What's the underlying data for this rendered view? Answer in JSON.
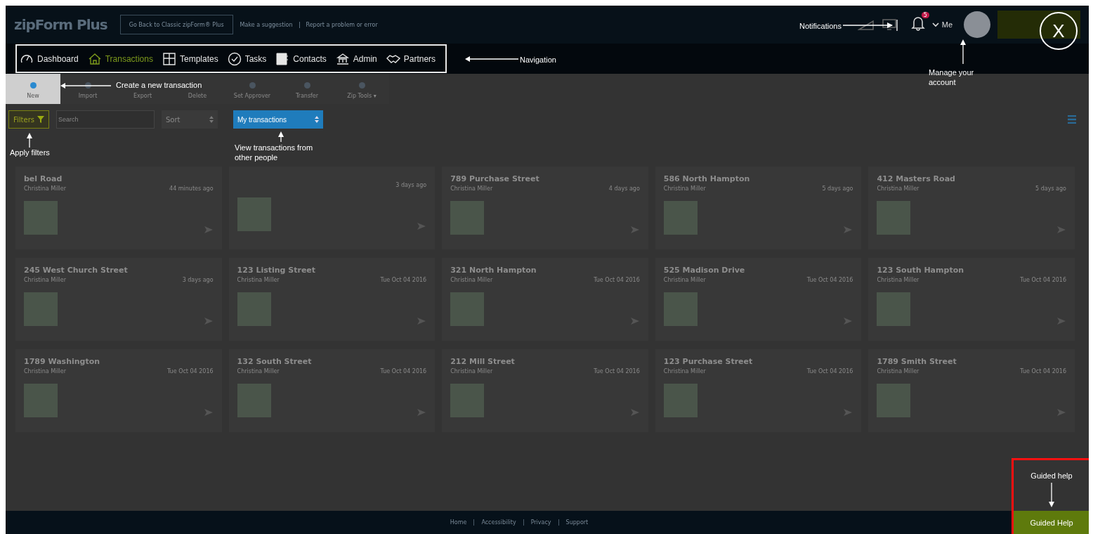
{
  "header": {
    "logo": "zipForm Plus",
    "back_button": "Go Back to Classic zipForm® Plus",
    "links": [
      "Make a suggestion",
      "Report a problem or error"
    ],
    "notification_count": "5",
    "account_menu": "Me"
  },
  "nav": [
    {
      "label": "Dashboard",
      "selected": false
    },
    {
      "label": "Transactions",
      "selected": true
    },
    {
      "label": "Templates",
      "selected": false
    },
    {
      "label": "Tasks",
      "selected": false
    },
    {
      "label": "Contacts",
      "selected": false
    },
    {
      "label": "Admin",
      "selected": false
    },
    {
      "label": "Partners",
      "selected": false
    }
  ],
  "toolbar": [
    {
      "label": "New",
      "selected": true
    },
    {
      "label": "Import",
      "selected": false
    },
    {
      "label": "Export",
      "selected": false
    },
    {
      "label": "Delete",
      "selected": false
    },
    {
      "label": "Set Approver",
      "selected": false
    },
    {
      "label": "Transfer",
      "selected": false
    },
    {
      "label": "Zip Tools ▾",
      "selected": false
    }
  ],
  "filters": {
    "filters_button": "Filters",
    "search_placeholder": "Search",
    "sort": "Sort",
    "view_select": "My transactions"
  },
  "cards": [
    {
      "title": "bel Road",
      "agent": "Christina Miller",
      "time": "44 minutes ago"
    },
    {
      "time": "3 days ago"
    },
    {
      "title": "789 Purchase Street",
      "agent": "Christina Miller",
      "time": "4 days ago"
    },
    {
      "title": "586 North Hampton",
      "agent": "Christina Miller",
      "time": "5 days ago"
    },
    {
      "title": "412 Masters Road",
      "agent": "Christina Miller",
      "time": "5 days ago"
    },
    {
      "title": "245 West Church Street",
      "agent": "Christina Miller",
      "time": "3 days ago"
    },
    {
      "title": "123 Listing Street",
      "agent": "Christina Miller",
      "time": "Tue Oct 04 2016"
    },
    {
      "title": "321 North Hampton",
      "agent": "Christina Miller",
      "time": "Tue Oct 04 2016"
    },
    {
      "title": "525 Madison Drive",
      "agent": "Christina Miller",
      "time": "Tue Oct 04 2016"
    },
    {
      "title": "123 South Hampton",
      "agent": "Christina Miller",
      "time": "Tue Oct 04 2016"
    },
    {
      "title": "1789 Washington",
      "agent": "Christina Miller",
      "time": "Tue Oct 04 2016"
    },
    {
      "title": "132 South Street",
      "agent": "Christina Miller",
      "time": "Tue Oct 04 2016"
    },
    {
      "title": "212 Mill Street",
      "agent": "Christina Miller",
      "time": "Tue Oct 04 2016"
    },
    {
      "title": "123 Purchase Street",
      "agent": "Christina Miller",
      "time": "Tue Oct 04 2016"
    },
    {
      "title": "1789 Smith Street",
      "agent": "Christina Miller",
      "time": "Tue Oct 04 2016"
    }
  ],
  "footer": [
    "Home",
    "Accessibility",
    "Privacy",
    "Support"
  ],
  "guided_help_button": "Guided Help",
  "tour": {
    "close": "X",
    "navigation": "Navigation",
    "create": "Create a new transaction",
    "filters": "Apply filters",
    "view": "View transactions from other people",
    "notifications": "Notifications",
    "account": "Manage your account",
    "guided": "Guided help"
  }
}
